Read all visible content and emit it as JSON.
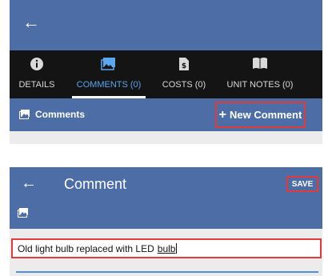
{
  "panel1": {
    "back_icon": "arrow-left-icon",
    "tabs": [
      {
        "label": "DETAILS",
        "icon": "info-icon",
        "active": false
      },
      {
        "label": "COMMENTS (0)",
        "icon": "image-icon",
        "active": true
      },
      {
        "label": "COSTS (0)",
        "icon": "cost-document-icon",
        "active": false
      },
      {
        "label": "UNIT NOTES (0)",
        "icon": "book-icon",
        "active": false
      }
    ],
    "subheader": {
      "title": "Comments",
      "new_button_label": "New Comment"
    }
  },
  "panel2": {
    "title": "Comment",
    "save_label": "SAVE",
    "input": {
      "value_prefix": "Old light bulb replaced with LED",
      "value_underlined": "bulb"
    }
  },
  "colors": {
    "header_blue": "#4d6da6",
    "tab_bar": "#141414",
    "active_tab_text": "#5aa7f0",
    "highlight_red": "#e03a3a",
    "input_line_blue": "#4d8fe0"
  }
}
